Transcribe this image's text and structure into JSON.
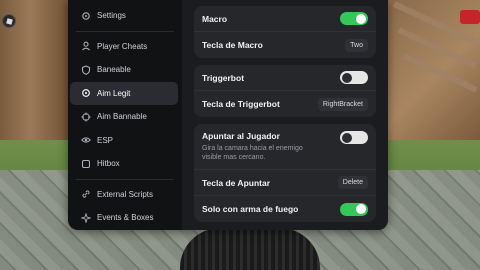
{
  "sidebar": {
    "items": [
      {
        "label": "Settings",
        "icon": "gear-icon"
      },
      {
        "label": "Player Cheats",
        "icon": "user-icon"
      },
      {
        "label": "Baneable",
        "icon": "shield-icon"
      },
      {
        "label": "Aim Legit",
        "icon": "crosshair-icon",
        "active": true
      },
      {
        "label": "Aim Bannable",
        "icon": "target-icon"
      },
      {
        "label": "ESP",
        "icon": "eye-icon"
      },
      {
        "label": "Hitbox",
        "icon": "box-icon"
      },
      {
        "label": "External Scripts",
        "icon": "link-icon"
      },
      {
        "label": "Events & Boxes",
        "icon": "sparkle-icon"
      }
    ]
  },
  "content": {
    "macro_label": "Macro",
    "macro_key_label": "Tecla de Macro",
    "macro_key_value": "Two",
    "triggerbot_label": "Triggerbot",
    "triggerbot_key_label": "Tecla de Triggerbot",
    "triggerbot_key_value": "RightBracket",
    "aim_label": "Apuntar al Jugador",
    "aim_desc": "Gira la camara hacia el enemigo visible mas cercano.",
    "aim_key_label": "Tecla de Apuntar",
    "aim_key_value": "Delete",
    "weapon_only_label": "Solo con arma de fuego"
  },
  "toggles": {
    "macro": true,
    "triggerbot": false,
    "aim": false,
    "weapon_only": true
  },
  "colors": {
    "accent": "#34c759",
    "panel": "#111214",
    "card": "#25272b"
  }
}
